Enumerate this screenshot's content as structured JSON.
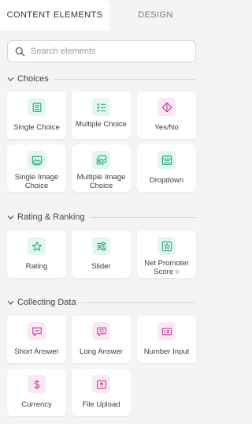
{
  "tabs": {
    "content": "CONTENT ELEMENTS",
    "design": "DESIGN"
  },
  "search": {
    "placeholder": "Search elements"
  },
  "sections": {
    "choices": {
      "title": "Choices",
      "items": [
        {
          "label": "Single Choice",
          "icon": "list-check-icon"
        },
        {
          "label": "Multiple Choice",
          "icon": "checklist-icon"
        },
        {
          "label": "Yes/No",
          "icon": "diamond-icon"
        },
        {
          "label": "Single Image Choice",
          "icon": "image-icon"
        },
        {
          "label": "Multiple Image Choice",
          "icon": "images-icon"
        },
        {
          "label": "Dropdown",
          "icon": "dropdown-icon"
        }
      ]
    },
    "rating": {
      "title": "Rating & Ranking",
      "items": [
        {
          "label": "Rating",
          "icon": "star-icon"
        },
        {
          "label": "Slider",
          "icon": "slider-icon"
        },
        {
          "label": "Net Promoter Score",
          "badge": "®",
          "icon": "star-box-icon"
        }
      ]
    },
    "collecting": {
      "title": "Collecting Data",
      "items": [
        {
          "label": "Short Answer",
          "icon": "short-answer-icon"
        },
        {
          "label": "Long Answer",
          "icon": "long-answer-icon"
        },
        {
          "label": "Number Input",
          "icon": "number-input-icon"
        },
        {
          "label": "Currency",
          "icon": "dollar-icon"
        },
        {
          "label": "File Upload",
          "icon": "upload-icon"
        }
      ]
    }
  },
  "colors": {
    "green_bg": "#e3f7ef",
    "green_icon": "#1fa37a",
    "pink_bg": "#fbe8f7",
    "pink_icon": "#c0389a"
  }
}
